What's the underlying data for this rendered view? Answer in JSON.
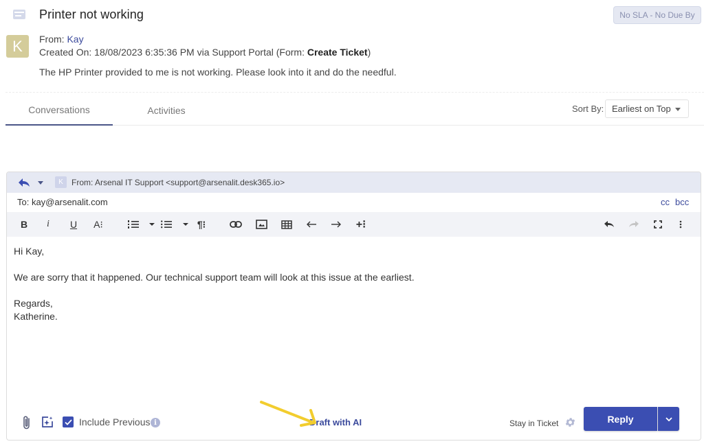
{
  "ticket": {
    "title": "Printer not working",
    "sla_badge": "No SLA - No Due By",
    "avatar_initial": "K",
    "from_label": "From:",
    "from_name": "Kay",
    "created_prefix": "Created On: 18/08/2023 6:35:36 PM via Support Portal (Form: ",
    "created_form": "Create Ticket",
    "created_suffix": ")",
    "description": "The HP Printer provided to me is not working. Please look into it and do the needful."
  },
  "tabs": [
    {
      "label": "Conversations",
      "active": true
    },
    {
      "label": "Activities",
      "active": false
    }
  ],
  "sort": {
    "label": "Sort By:",
    "selected": "Earliest on Top"
  },
  "composer": {
    "from_avatar_initial": "K",
    "from_text": "From:  Arsenal IT Support <support@arsenalit.desk365.io>",
    "to_text": "To: kay@arsenalit.com",
    "cc_label": "cc",
    "bcc_label": "bcc",
    "toolbar": {
      "bold": "B",
      "italic": "i",
      "underline": "U",
      "font_size": "A⁝",
      "paragraph": "¶⁝",
      "more_insert": "+⁝"
    },
    "body": {
      "greeting": "Hi Kay,",
      "message": "We are sorry that it happened. Our technical support team will look at this issue at the earliest.",
      "closing": "Regards,",
      "signature": "Katherine."
    },
    "footer": {
      "include_previous_label": "Include Previous",
      "include_previous_checked": true,
      "draft_ai_label": "Draft with AI",
      "stay_label": "Stay in Ticket",
      "reply_label": "Reply"
    }
  },
  "colors": {
    "accent": "#3b4eb2",
    "link": "#3b4a9c",
    "annotation_arrow": "#f2cd2e",
    "avatar": "#d4cc9a"
  }
}
